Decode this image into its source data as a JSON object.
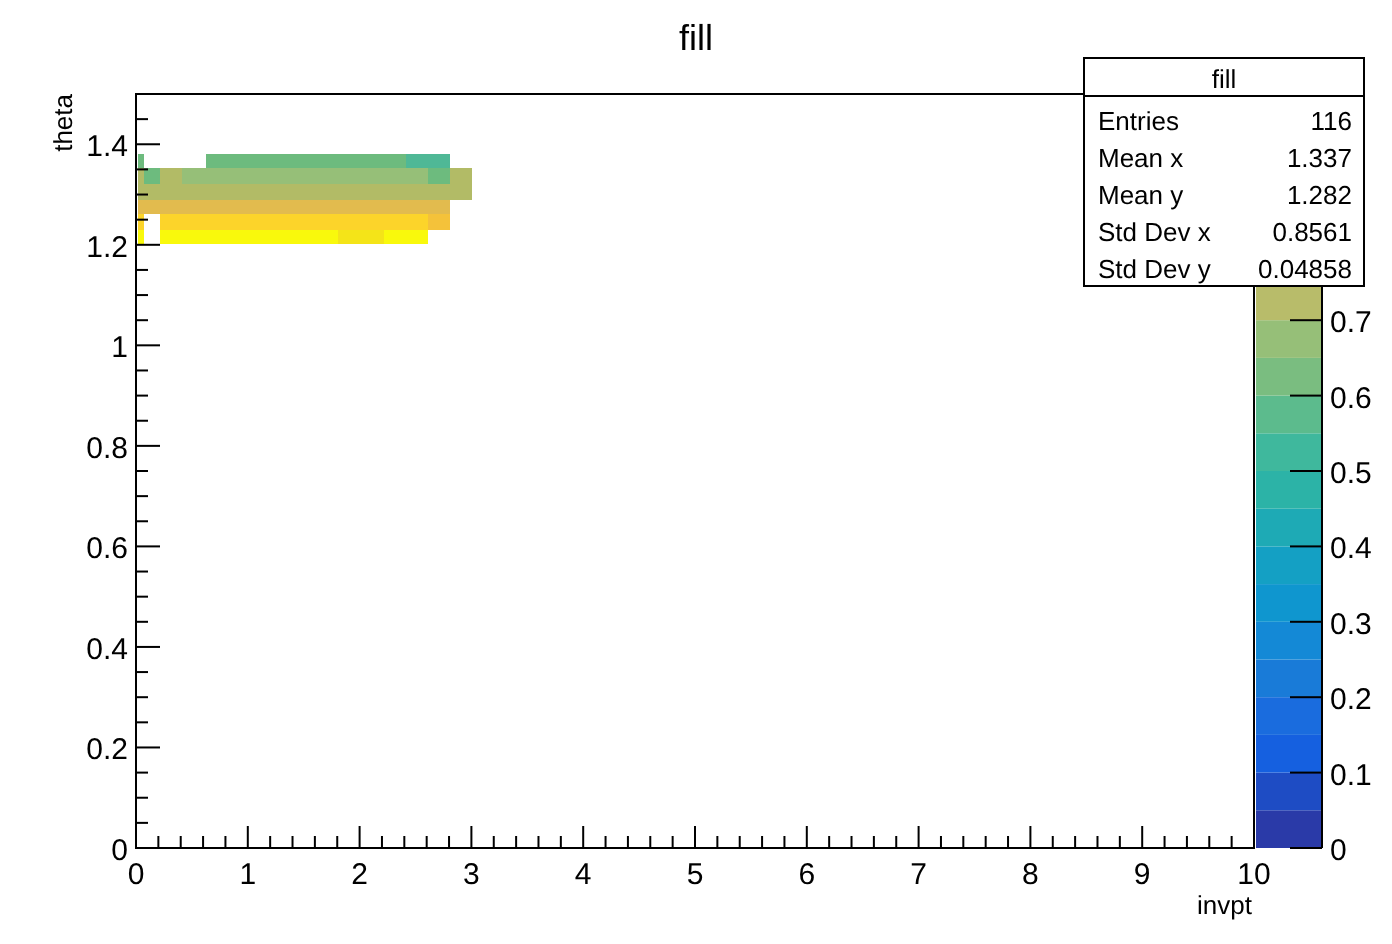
{
  "title": "fill",
  "x_axis": {
    "label": "invpt",
    "ticks": [
      "0",
      "1",
      "2",
      "3",
      "4",
      "5",
      "6",
      "7",
      "8",
      "9",
      "10"
    ]
  },
  "y_axis": {
    "label": "theta",
    "ticks": [
      "1.4",
      "1.2",
      "1",
      "0.8",
      "0.6",
      "0.4",
      "0.2",
      "0"
    ]
  },
  "color_scale": {
    "ticks": [
      "0.7",
      "0.6",
      "0.5",
      "0.4",
      "0.3",
      "0.2",
      "0.1",
      "0"
    ]
  },
  "stats_box": {
    "title": "fill",
    "rows": [
      {
        "label": "Entries",
        "value": "116"
      },
      {
        "label": "Mean x",
        "value": "1.337"
      },
      {
        "label": "Mean y",
        "value": "1.282"
      },
      {
        "label": "Std Dev x",
        "value": "0.8561"
      },
      {
        "label": "Std Dev y",
        "value": "0.04858"
      }
    ]
  }
}
